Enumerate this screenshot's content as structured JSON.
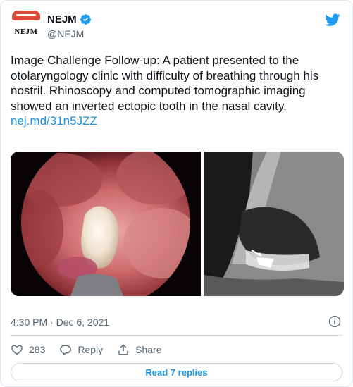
{
  "account": {
    "display_name": "NEJM",
    "handle": "@NEJM",
    "logo_text": "NEJM",
    "verified": true
  },
  "tweet": {
    "text": "Image Challenge Follow-up: A patient presented to the otolaryngology clinic with difficulty of breathing through his nostril. Rhinoscopy and computed tomographic imaging showed an inverted ectopic tooth in the nasal cavity.",
    "link": "nej.md/31n5JZZ"
  },
  "media": {
    "left_image": "endoscopic-rhinoscopy-photo",
    "right_image": "ct-scan-sagittal"
  },
  "meta": {
    "timestamp": "4:30 PM · Dec 6, 2021"
  },
  "actions": {
    "like_count": "283",
    "reply_label": "Reply",
    "share_label": "Share"
  },
  "footer": {
    "read_replies": "Read 7 replies"
  },
  "colors": {
    "accent": "#1b95e0",
    "verified": "#1d9bf0",
    "text_secondary": "#536471",
    "logo_red": "#d94a3a"
  },
  "icons": [
    "verified-badge-icon",
    "twitter-bird-icon",
    "info-icon",
    "heart-icon",
    "reply-icon",
    "share-icon"
  ]
}
